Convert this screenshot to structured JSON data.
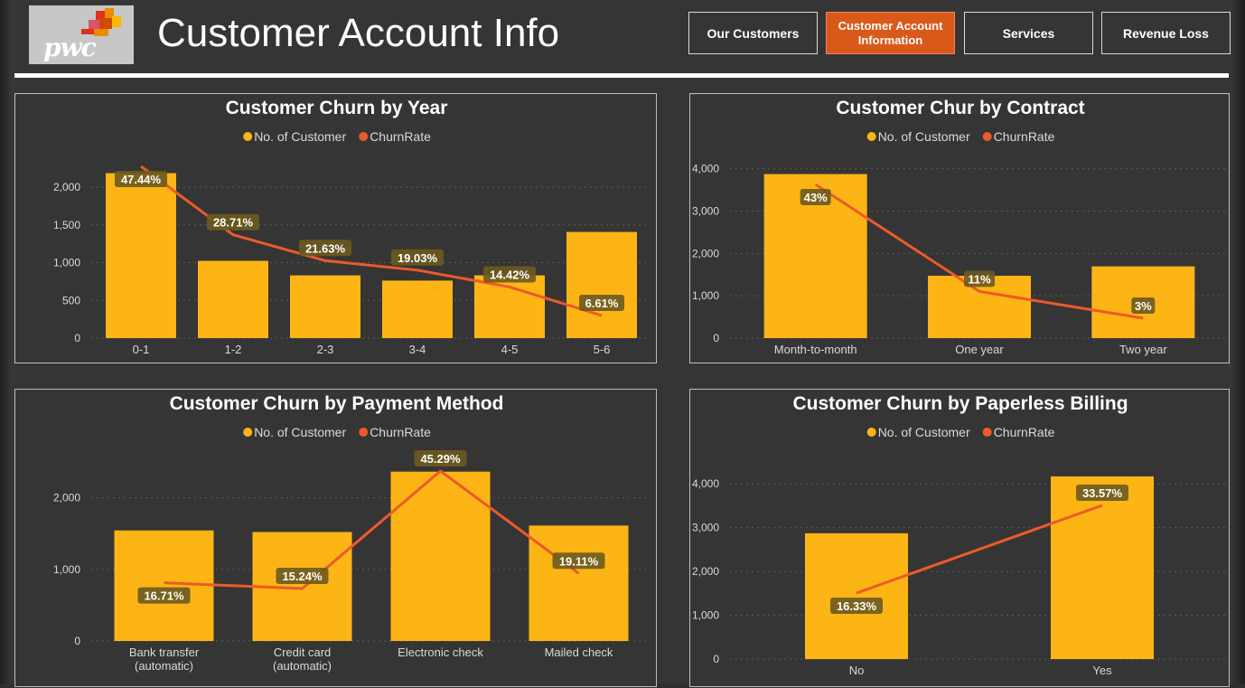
{
  "header": {
    "logo_text": "pwc",
    "title": "Customer Account Info"
  },
  "nav": [
    {
      "label": "Our Customers",
      "active": false
    },
    {
      "label": "Customer Account Information",
      "active": true
    },
    {
      "label": "Services",
      "active": false
    },
    {
      "label": "Revenue Loss",
      "active": false
    }
  ],
  "colors": {
    "bar": "#fdb515",
    "line": "#ec5a2a",
    "active_nav": "#d9591b",
    "background": "#353535"
  },
  "legend": {
    "bar_label": "No. of Customer",
    "line_label": "ChurnRate"
  },
  "chart_data": [
    {
      "type": "bar",
      "title": "Customer Churn by Year",
      "categories": [
        "0-1",
        "1-2",
        "2-3",
        "3-4",
        "4-5",
        "5-6"
      ],
      "series": [
        {
          "name": "No. of Customer",
          "type": "bar",
          "values": [
            2186,
            1024,
            832,
            762,
            832,
            1407
          ]
        },
        {
          "name": "ChurnRate",
          "type": "line",
          "values": [
            47.44,
            28.71,
            21.63,
            19.03,
            14.42,
            6.61
          ],
          "labels": [
            "47.44%",
            "28.71%",
            "21.63%",
            "19.03%",
            "14.42%",
            "6.61%"
          ]
        }
      ],
      "yticks": [
        0,
        500,
        1000,
        1500,
        2000
      ],
      "ytick_labels": [
        "0",
        "500",
        "1,000",
        "1,500",
        "2,000"
      ],
      "ylim": [
        0,
        2300
      ]
    },
    {
      "type": "bar",
      "title": "Customer Chur by Contract",
      "categories": [
        "Month-to-month",
        "One year",
        "Two year"
      ],
      "series": [
        {
          "name": "No. of Customer",
          "type": "bar",
          "values": [
            3875,
            1473,
            1695
          ]
        },
        {
          "name": "ChurnRate",
          "type": "line",
          "values": [
            43,
            11,
            3
          ],
          "labels": [
            "43%",
            "11%",
            "3%"
          ]
        }
      ],
      "yticks": [
        0,
        1000,
        2000,
        3000,
        4000
      ],
      "ytick_labels": [
        "0",
        "1,000",
        "2,000",
        "3,000",
        "4,000"
      ],
      "ylim": [
        0,
        4100
      ]
    },
    {
      "type": "bar",
      "title": "Customer Churn by Payment Method",
      "categories": [
        "Bank transfer (automatic)",
        "Credit card (automatic)",
        "Electronic check",
        "Mailed check"
      ],
      "series": [
        {
          "name": "No. of Customer",
          "type": "bar",
          "values": [
            1544,
            1522,
            2365,
            1612
          ]
        },
        {
          "name": "ChurnRate",
          "type": "line",
          "values": [
            16.71,
            15.24,
            45.29,
            19.11
          ],
          "labels": [
            "16.71%",
            "15.24%",
            "45.29%",
            "19.11%"
          ]
        }
      ],
      "yticks": [
        0,
        1000,
        2000
      ],
      "ytick_labels": [
        "0",
        "1,000",
        "2,000"
      ],
      "ylim": [
        0,
        2500
      ]
    },
    {
      "type": "bar",
      "title": "Customer Churn by Paperless Billing",
      "categories": [
        "No",
        "Yes"
      ],
      "series": [
        {
          "name": "No. of Customer",
          "type": "bar",
          "values": [
            2872,
            4171
          ]
        },
        {
          "name": "ChurnRate",
          "type": "line",
          "values": [
            16.33,
            33.57
          ],
          "labels": [
            "16.33%",
            "33.57%"
          ]
        }
      ],
      "yticks": [
        0,
        1000,
        2000,
        3000,
        4000
      ],
      "ytick_labels": [
        "0",
        "1,000",
        "2,000",
        "3,000",
        "4,000"
      ],
      "ylim": [
        0,
        4500
      ]
    }
  ]
}
